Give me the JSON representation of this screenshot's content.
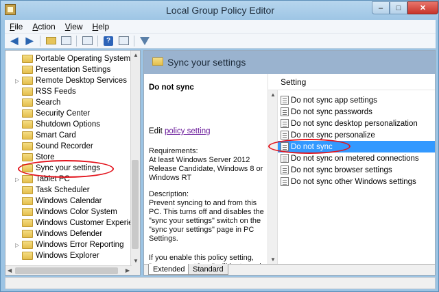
{
  "window": {
    "title": "Local Group Policy Editor"
  },
  "titlebar_buttons": {
    "minimize": "–",
    "maximize": "□",
    "close": "✕"
  },
  "menu": [
    {
      "accel": "F",
      "rest": "ile"
    },
    {
      "accel": "A",
      "rest": "ction"
    },
    {
      "accel": "V",
      "rest": "iew"
    },
    {
      "accel": "H",
      "rest": "elp"
    }
  ],
  "toolbar": {
    "back_icon": "◀",
    "forward_icon": "▶",
    "help_icon": "?"
  },
  "tree": {
    "items": [
      {
        "label": "Portable Operating System",
        "expander": ""
      },
      {
        "label": "Presentation Settings",
        "expander": ""
      },
      {
        "label": "Remote Desktop Services",
        "expander": "▷"
      },
      {
        "label": "RSS Feeds",
        "expander": ""
      },
      {
        "label": "Search",
        "expander": ""
      },
      {
        "label": "Security Center",
        "expander": ""
      },
      {
        "label": "Shutdown Options",
        "expander": ""
      },
      {
        "label": "Smart Card",
        "expander": ""
      },
      {
        "label": "Sound Recorder",
        "expander": ""
      },
      {
        "label": "Store",
        "expander": ""
      },
      {
        "label": "Sync your settings",
        "expander": ""
      },
      {
        "label": "Tablet PC",
        "expander": "▷"
      },
      {
        "label": "Task Scheduler",
        "expander": ""
      },
      {
        "label": "Windows Calendar",
        "expander": ""
      },
      {
        "label": "Windows Color System",
        "expander": ""
      },
      {
        "label": "Windows Customer Experien",
        "expander": ""
      },
      {
        "label": "Windows Defender",
        "expander": ""
      },
      {
        "label": "Windows Error Reporting",
        "expander": "▷"
      },
      {
        "label": "Windows Explorer",
        "expander": ""
      }
    ]
  },
  "details": {
    "header": "Sync your settings",
    "selected_title": "Do not sync",
    "edit_prefix": "Edit ",
    "edit_link": "policy setting",
    "requirements_label": "Requirements:",
    "requirements_text": "At least Windows Server 2012 Release Candidate, Windows 8 or Windows RT",
    "description_label": "Description:",
    "description_text": "Prevent syncing to and from this PC.  This turns off and disables the \"sync your settings\" switch on the \"sync your settings\" page in PC Settings.",
    "enable_text": "If you enable this policy setting, \"sync your settings\" will be turned off, and none of the \"sync your setting\" groups will"
  },
  "settings": {
    "column_header": "Setting",
    "rows": [
      "Do not sync app settings",
      "Do not sync passwords",
      "Do not sync desktop personalization",
      "Do not sync personalize",
      "Do not sync",
      "Do not sync on metered connections",
      "Do not sync browser settings",
      "Do not sync other Windows settings"
    ],
    "selected_index": 4
  },
  "tabs": {
    "extended": "Extended",
    "standard": "Standard"
  },
  "scroll": {
    "up": "▲",
    "down": "▼",
    "left": "◀",
    "right": "▶"
  },
  "colors": {
    "annotation": "#e3141d",
    "selection": "#3399ff"
  }
}
